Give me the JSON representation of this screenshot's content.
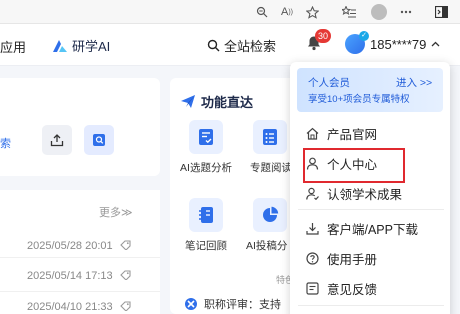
{
  "header": {
    "apps_label": "应用",
    "ai_label": "研学AI",
    "search_label": "全站检索",
    "notification_count": "30",
    "user_phone": "185****79"
  },
  "left": {
    "search_text": "索",
    "more_label": "更多≫",
    "rows": [
      {
        "date": "2025/05/28 20:01"
      },
      {
        "date": "2025/05/14 17:13"
      },
      {
        "date": "2025/04/10 21:33"
      }
    ]
  },
  "functions": {
    "title": "功能直达",
    "tiles": [
      {
        "label": "AI选题分析",
        "icon": "checklist-icon"
      },
      {
        "label": "专题阅读",
        "icon": "list-icon"
      },
      {
        "label": "笔记回顾",
        "icon": "notebook-icon"
      },
      {
        "label": "AI投稿分",
        "icon": "pie-chart-icon"
      }
    ],
    "feature_note": "特色",
    "news_text": "职称评审：支持"
  },
  "menu": {
    "vip_title": "个人会员",
    "vip_enter": "进入 >>",
    "vip_sub": "享受10+项会员专属特权",
    "items": [
      {
        "label": "产品官网",
        "icon": "home-icon"
      },
      {
        "label": "个人中心",
        "icon": "user-icon"
      },
      {
        "label": "认领学术成果",
        "icon": "user-check-icon"
      },
      {
        "label": "客户端/APP下载",
        "icon": "download-icon"
      },
      {
        "label": "使用手册",
        "icon": "help-icon"
      },
      {
        "label": "意见反馈",
        "icon": "feedback-icon"
      }
    ]
  },
  "colors": {
    "accent": "#2f6fea",
    "highlight": "#e0292f",
    "badge": "#e53935"
  }
}
